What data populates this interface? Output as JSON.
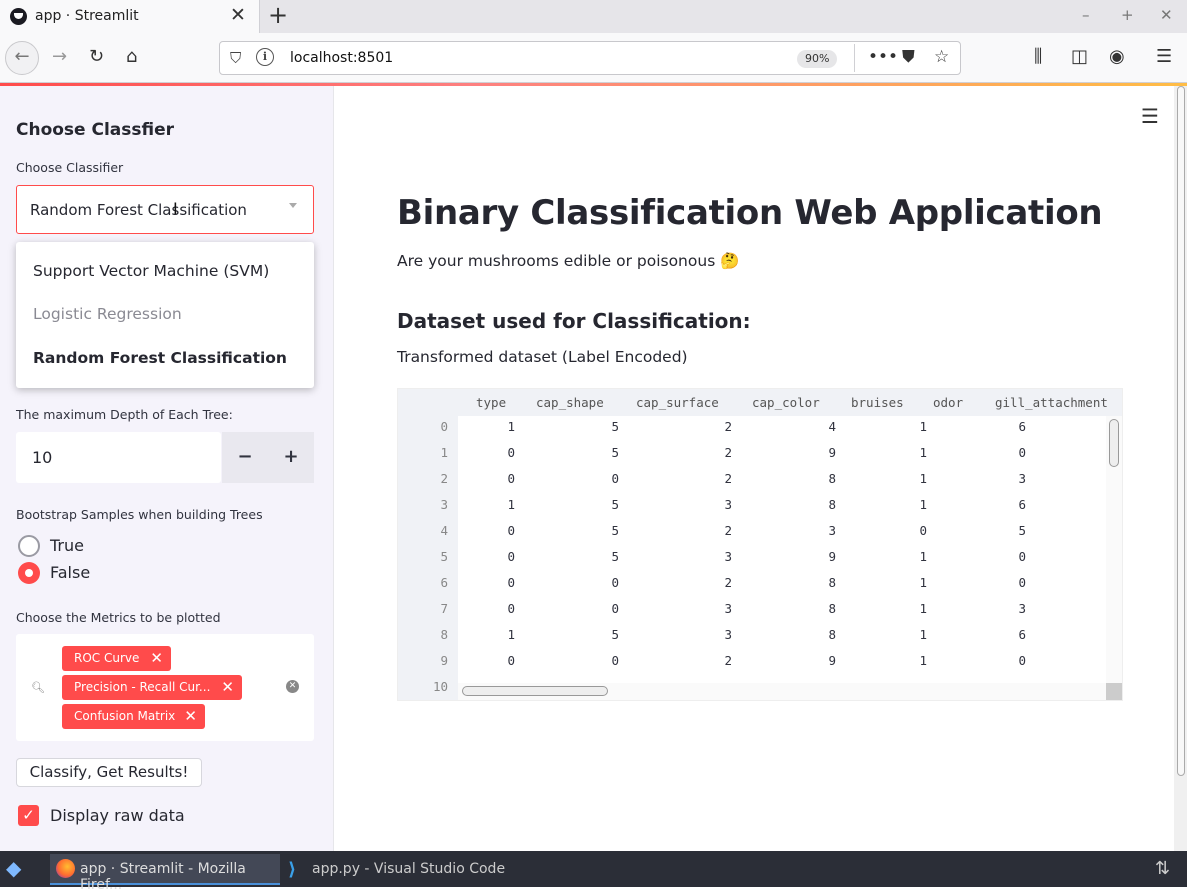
{
  "browser": {
    "tab_title": "app · Streamlit",
    "url": "localhost:8501",
    "zoom": "90%",
    "icons": [
      "close-icon",
      "new-tab-icon",
      "back-icon",
      "forward-icon",
      "reload-icon",
      "home-icon",
      "shield-icon",
      "info-icon",
      "more-icon",
      "pocket-icon",
      "star-icon",
      "library-icon",
      "sidebar-icon",
      "account-icon",
      "menu-icon"
    ]
  },
  "sidebar": {
    "header": "Choose Classfier",
    "classifier_label": "Choose Classifier",
    "classifier_value": "Random Forest Classification",
    "options": [
      "Support Vector Machine (SVM)",
      "Logistic Regression",
      "Random Forest Classification"
    ],
    "depth_label": "The maximum Depth of Each Tree:",
    "depth_value": "10",
    "minus": "−",
    "plus": "+",
    "bootstrap_label": "Bootstrap Samples when building Trees",
    "bootstrap_options": [
      "True",
      "False"
    ],
    "bootstrap_selected": "False",
    "metrics_label": "Choose the Metrics to be plotted",
    "metrics": [
      "ROC Curve",
      "Precision - Recall Cur...",
      "Confusion Matrix"
    ],
    "classify_button": "Classify, Get Results!",
    "display_raw_label": "Display raw data",
    "display_raw_checked": true
  },
  "main": {
    "title": "Binary Classification Web Application",
    "subtitle": "Are your mushrooms edible or poisonous 🤔",
    "dataset_header": "Dataset used for Classification:",
    "dataset_caption": "Transformed dataset (Label Encoded)",
    "table": {
      "columns": [
        "type",
        "cap_shape",
        "cap_surface",
        "cap_color",
        "bruises",
        "odor",
        "gill_attachment"
      ],
      "rows": [
        {
          "index": "0",
          "values": [
            "1",
            "5",
            "2",
            "4",
            "1",
            "6",
            ""
          ]
        },
        {
          "index": "1",
          "values": [
            "0",
            "5",
            "2",
            "9",
            "1",
            "0",
            ""
          ]
        },
        {
          "index": "2",
          "values": [
            "0",
            "0",
            "2",
            "8",
            "1",
            "3",
            ""
          ]
        },
        {
          "index": "3",
          "values": [
            "1",
            "5",
            "3",
            "8",
            "1",
            "6",
            ""
          ]
        },
        {
          "index": "4",
          "values": [
            "0",
            "5",
            "2",
            "3",
            "0",
            "5",
            ""
          ]
        },
        {
          "index": "5",
          "values": [
            "0",
            "5",
            "3",
            "9",
            "1",
            "0",
            ""
          ]
        },
        {
          "index": "6",
          "values": [
            "0",
            "0",
            "2",
            "8",
            "1",
            "0",
            ""
          ]
        },
        {
          "index": "7",
          "values": [
            "0",
            "0",
            "3",
            "8",
            "1",
            "3",
            ""
          ]
        },
        {
          "index": "8",
          "values": [
            "1",
            "5",
            "3",
            "8",
            "1",
            "6",
            ""
          ]
        },
        {
          "index": "9",
          "values": [
            "0",
            "0",
            "2",
            "9",
            "1",
            "0",
            ""
          ]
        },
        {
          "index": "10",
          "values": [
            "",
            "",
            "",
            "",
            "",
            "",
            ""
          ]
        }
      ]
    }
  },
  "taskbar": {
    "firefox_item": "app · Streamlit - Mozilla Firef...",
    "vscode_item": "app.py - Visual Studio Code"
  }
}
